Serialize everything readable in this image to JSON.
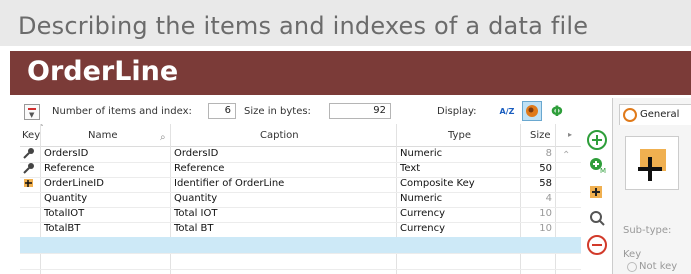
{
  "page_title": "Describing the items and indexes of a data file",
  "banner_title": "OrderLine",
  "toolbar": {
    "items_label": "Number of items and index:",
    "items_value": "6",
    "size_label": "Size in bytes:",
    "size_value": "92",
    "display_label": "Display:",
    "az_label": "A/Z",
    "phi_label": "Φ"
  },
  "columns": {
    "key": "Key",
    "name": "Name",
    "caption": "Caption",
    "type": "Type",
    "size": "Size"
  },
  "rows": [
    {
      "name": "OrdersID",
      "caption": "OrdersID",
      "type": "Numeric",
      "size": "8",
      "key_icon": "key-icon"
    },
    {
      "name": "Reference",
      "caption": "Reference",
      "type": "Text",
      "size": "50",
      "key_icon": "key-icon"
    },
    {
      "name": "OrderLineID",
      "caption": "Identifier of OrderLine",
      "type": "Composite Key",
      "size": "58",
      "key_icon": "composite-key-icon"
    },
    {
      "name": "Quantity",
      "caption": "Quantity",
      "type": "Numeric",
      "size": "4",
      "key_icon": ""
    },
    {
      "name": "TotalIOT",
      "caption": "Total IOT",
      "type": "Currency",
      "size": "10",
      "key_icon": ""
    },
    {
      "name": "TotalBT",
      "caption": "Total BT",
      "type": "Currency",
      "size": "10",
      "key_icon": ""
    }
  ],
  "right_panel": {
    "tab_general": "General",
    "subtype_label": "Sub-type:",
    "key_label": "Key",
    "not_key_label": "Not key"
  },
  "colors": {
    "banner": "#7b3b38",
    "selected_row": "#cde9f7",
    "add": "#2e9e3a",
    "remove": "#d23a2a"
  }
}
